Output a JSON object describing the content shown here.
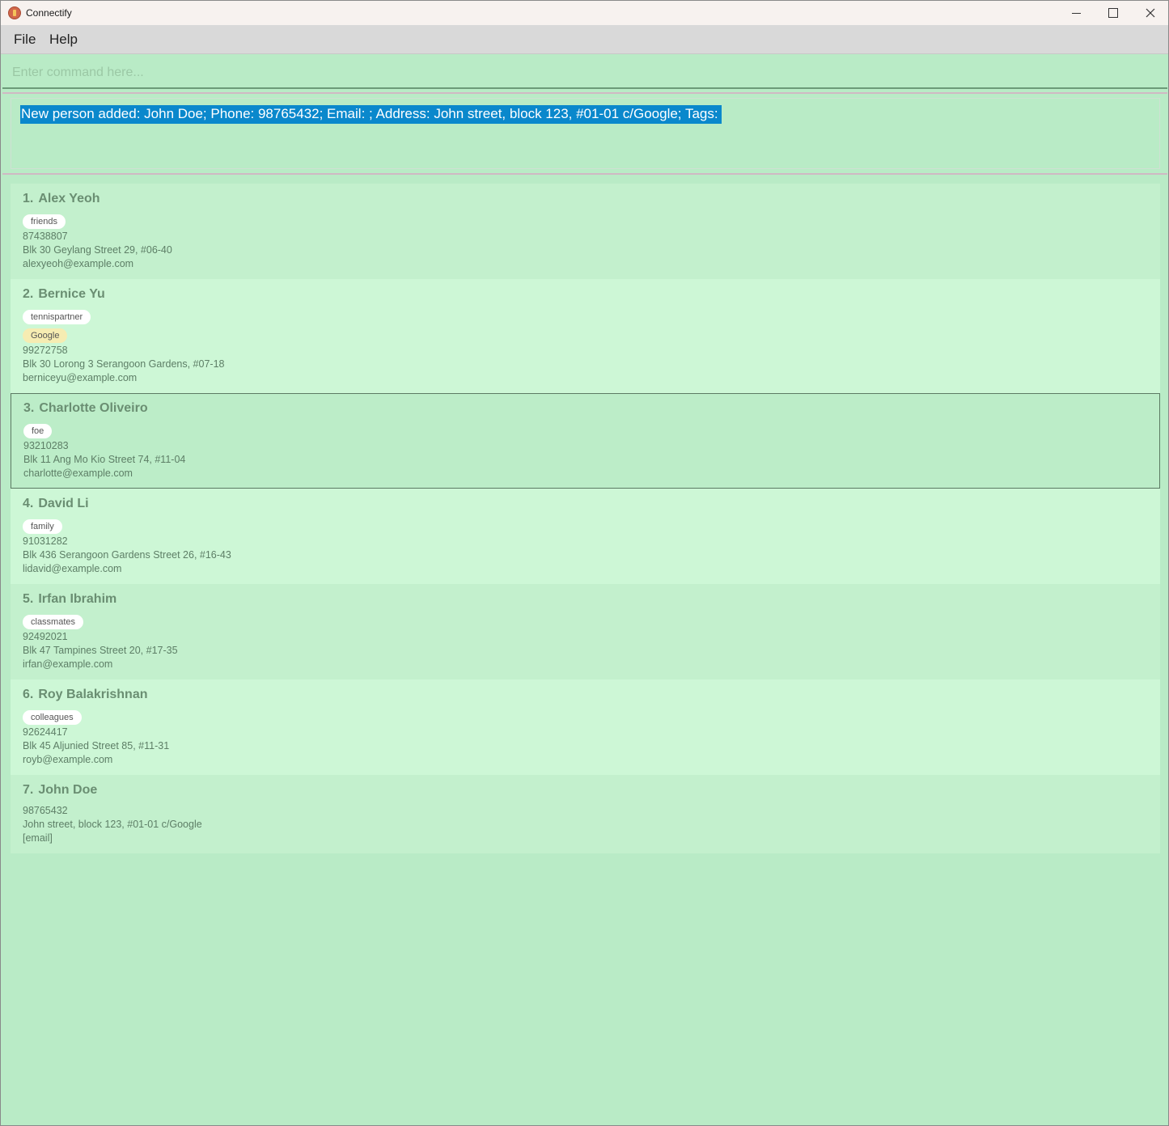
{
  "window": {
    "title": "Connectify"
  },
  "menu": {
    "file": "File",
    "help": "Help"
  },
  "command": {
    "placeholder": "Enter command here...",
    "value": ""
  },
  "result": {
    "message": "New person added: John Doe; Phone: 98765432; Email: ; Address: John street, block 123, #01-01 c/Google; Tags: "
  },
  "persons": [
    {
      "index": "1.",
      "name": "Alex Yeoh",
      "tags": [
        "friends"
      ],
      "company": "",
      "phone": "87438807",
      "address": "Blk 30 Geylang Street 29, #06-40",
      "email": "alexyeoh@example.com"
    },
    {
      "index": "2.",
      "name": "Bernice Yu",
      "tags": [
        "tennispartner"
      ],
      "company": "Google",
      "phone": "99272758",
      "address": "Blk 30 Lorong 3 Serangoon Gardens, #07-18",
      "email": "berniceyu@example.com"
    },
    {
      "index": "3.",
      "name": "Charlotte Oliveiro",
      "tags": [
        "foe"
      ],
      "company": "",
      "phone": "93210283",
      "address": "Blk 11 Ang Mo Kio Street 74, #11-04",
      "email": "charlotte@example.com"
    },
    {
      "index": "4.",
      "name": "David Li",
      "tags": [
        "family"
      ],
      "company": "",
      "phone": "91031282",
      "address": "Blk 436 Serangoon Gardens Street 26, #16-43",
      "email": "lidavid@example.com"
    },
    {
      "index": "5.",
      "name": "Irfan Ibrahim",
      "tags": [
        "classmates"
      ],
      "company": "",
      "phone": "92492021",
      "address": "Blk 47 Tampines Street 20, #17-35",
      "email": "irfan@example.com"
    },
    {
      "index": "6.",
      "name": "Roy Balakrishnan",
      "tags": [
        "colleagues"
      ],
      "company": "",
      "phone": "92624417",
      "address": "Blk 45 Aljunied Street 85, #11-31",
      "email": "royb@example.com"
    },
    {
      "index": "7.",
      "name": "John Doe",
      "tags": [],
      "company": "",
      "phone": "98765432",
      "address": "John street, block 123, #01-01 c/Google",
      "email": "[email]"
    }
  ],
  "selected_index": 2
}
